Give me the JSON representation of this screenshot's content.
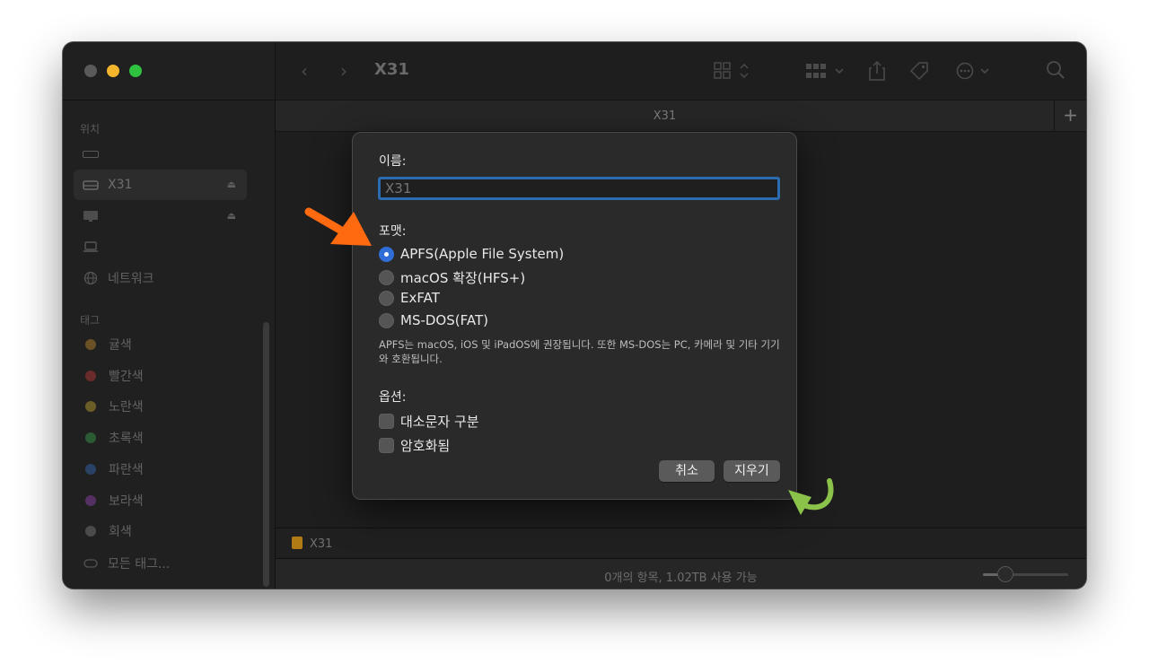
{
  "window": {
    "title": "X31",
    "tab_label": "X31",
    "tab_add": "+"
  },
  "sidebar": {
    "locations_header": "위치",
    "selected_item": "X31",
    "network_item": "네트워크",
    "tags_header": "태그",
    "tags": [
      {
        "label": "귤색",
        "color": "#6b5226"
      },
      {
        "label": "빨간색",
        "color": "#6a2c2a"
      },
      {
        "label": "노란색",
        "color": "#6b5d25"
      },
      {
        "label": "초록색",
        "color": "#2b5a33"
      },
      {
        "label": "파란색",
        "color": "#2a4266"
      },
      {
        "label": "보라색",
        "color": "#553063"
      },
      {
        "label": "회색",
        "color": "#4b4b4b"
      }
    ],
    "all_tags": "모든 태그..."
  },
  "dialog": {
    "name_label": "이름:",
    "name_placeholder": "X31",
    "format_label": "포맷:",
    "formats": [
      {
        "label": "APFS(Apple File System)",
        "checked": true
      },
      {
        "label": "macOS 확장(HFS+)",
        "checked": false
      },
      {
        "label": "ExFAT",
        "checked": false
      },
      {
        "label": "MS-DOS(FAT)",
        "checked": false
      }
    ],
    "description": "APFS는 macOS, iOS 및 iPadOS에 권장됩니다. 또한 MS-DOS는 PC, 카메라 및 기타 기기와 호환됩니다.",
    "options_label": "옵션:",
    "options": [
      {
        "label": "대소문자 구분"
      },
      {
        "label": "암호화됨"
      }
    ],
    "cancel_label": "취소",
    "erase_label": "지우기"
  },
  "pathbar": {
    "label": "X31"
  },
  "status": {
    "text": "0개의 항목, 1.02TB 사용 가능",
    "zoom": 0.2
  },
  "colors": {
    "accent": "#2e6ed6",
    "arrow_orange": "#ff6a10",
    "arrow_green": "#8bc34a"
  }
}
